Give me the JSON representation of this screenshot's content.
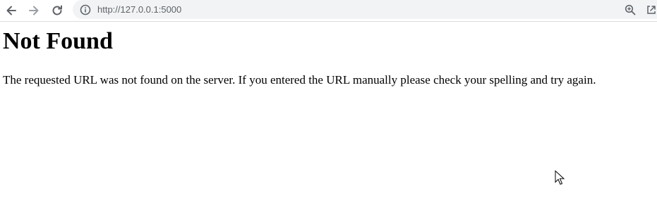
{
  "browser": {
    "url": "http://127.0.0.1:5000",
    "icons": {
      "back": "arrow-left-icon",
      "forward": "arrow-right-icon",
      "reload": "reload-icon",
      "info": "info-icon",
      "zoom": "zoom-in-icon",
      "share": "share-icon"
    }
  },
  "page": {
    "heading": "Not Found",
    "message": "The requested URL was not found on the server. If you entered the URL manually please check your spelling and try again."
  },
  "colors": {
    "toolbar_bg": "#ffffff",
    "omnibox_bg": "#f1f3f4",
    "icon": "#5f6368",
    "icon_disabled": "#9aa0a6",
    "text": "#000000"
  }
}
